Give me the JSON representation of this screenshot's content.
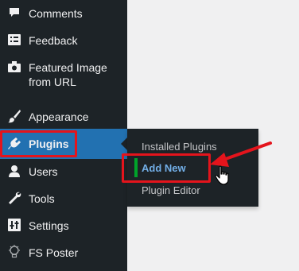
{
  "sidebar": {
    "items": [
      {
        "label": "Comments",
        "icon": "comment-icon"
      },
      {
        "label": "Feedback",
        "icon": "feedback-icon"
      },
      {
        "label": "Featured Image",
        "label2": "from URL",
        "icon": "camera-icon"
      },
      {
        "label": "Appearance",
        "icon": "paintbrush-icon"
      },
      {
        "label": "Plugins",
        "icon": "plugin-icon",
        "active": true
      },
      {
        "label": "Users",
        "icon": "user-icon"
      },
      {
        "label": "Tools",
        "icon": "wrench-icon"
      },
      {
        "label": "Settings",
        "icon": "settings-icon"
      },
      {
        "label": "FS Poster",
        "icon": "lightbulb-icon"
      }
    ]
  },
  "submenu": {
    "items": [
      {
        "label": "Installed Plugins"
      },
      {
        "label": "Add New",
        "current": true
      },
      {
        "label": "Plugin Editor"
      }
    ]
  },
  "colors": {
    "sidebar_bg": "#1d2327",
    "active_bg": "#2271b1",
    "highlight_red": "#e4141c",
    "focus_green": "#00a32a"
  }
}
